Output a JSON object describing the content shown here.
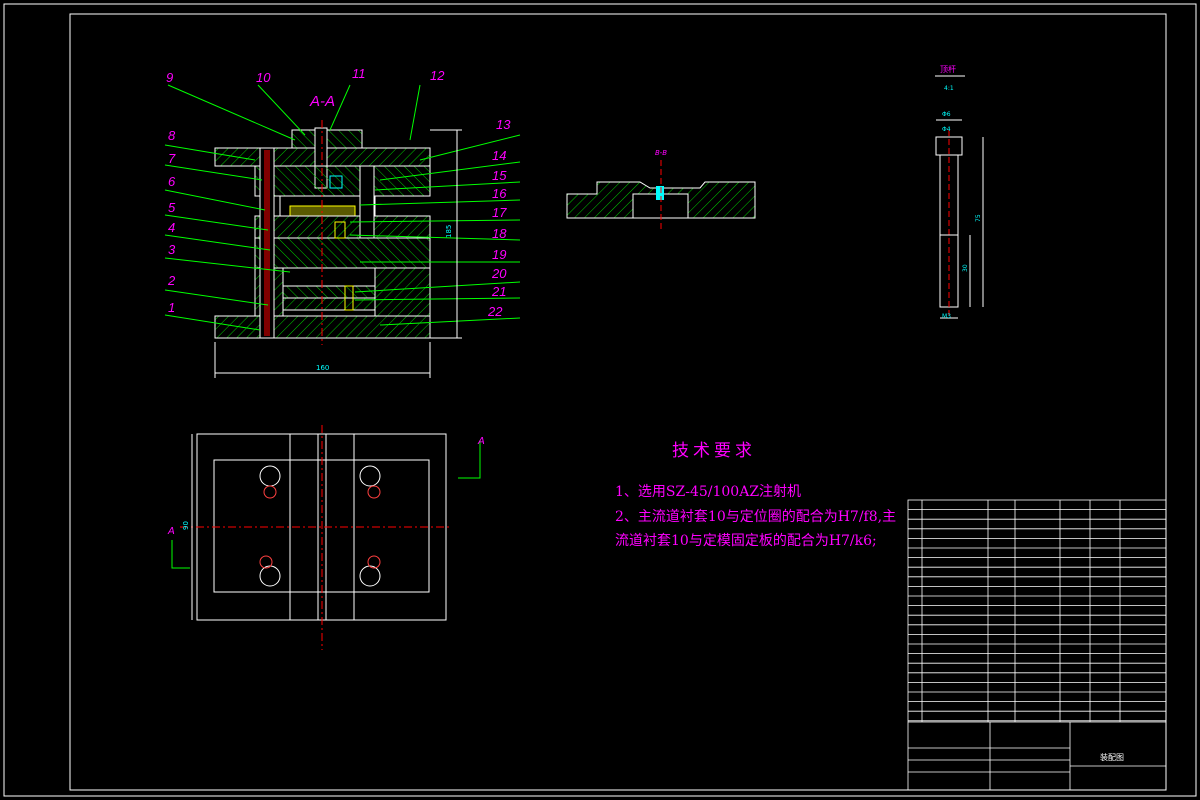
{
  "section_label": "A-A",
  "part_numbers": [
    "1",
    "2",
    "3",
    "4",
    "5",
    "6",
    "7",
    "8",
    "9",
    "10",
    "11",
    "12",
    "13",
    "14",
    "15",
    "16",
    "17",
    "18",
    "19",
    "20",
    "21",
    "22"
  ],
  "dimensions": {
    "overall_width": "160",
    "overall_height": "185",
    "plan_height": "90",
    "section_callout": "A",
    "detail_callout": "B-B"
  },
  "detail_part": {
    "title": "顶杆",
    "dim_top": "4:1",
    "dim_head": "Φ6",
    "dim_mid": "Φ4",
    "dim_length": "75",
    "dim_lower": "30",
    "dim_bottom": "M3"
  },
  "technical_requirements": {
    "title": "技术要求",
    "line1": "1、选用SZ-45/100AZ注射机",
    "line2": "2、主流道衬套10与定位圈的配合为H7/f8,主",
    "line3": "流道衬套10与定模固定板的配合为H7/k6;"
  },
  "title_block": {
    "drawing_name": "装配图"
  },
  "colors": {
    "background": "#000000",
    "outline": "#ffffff",
    "hatch_section": "#00ff00",
    "part_labels": "#ff00ff",
    "centerline": "#ff0000",
    "dimensions": "#00ffff",
    "bolts": "#ffff00"
  }
}
